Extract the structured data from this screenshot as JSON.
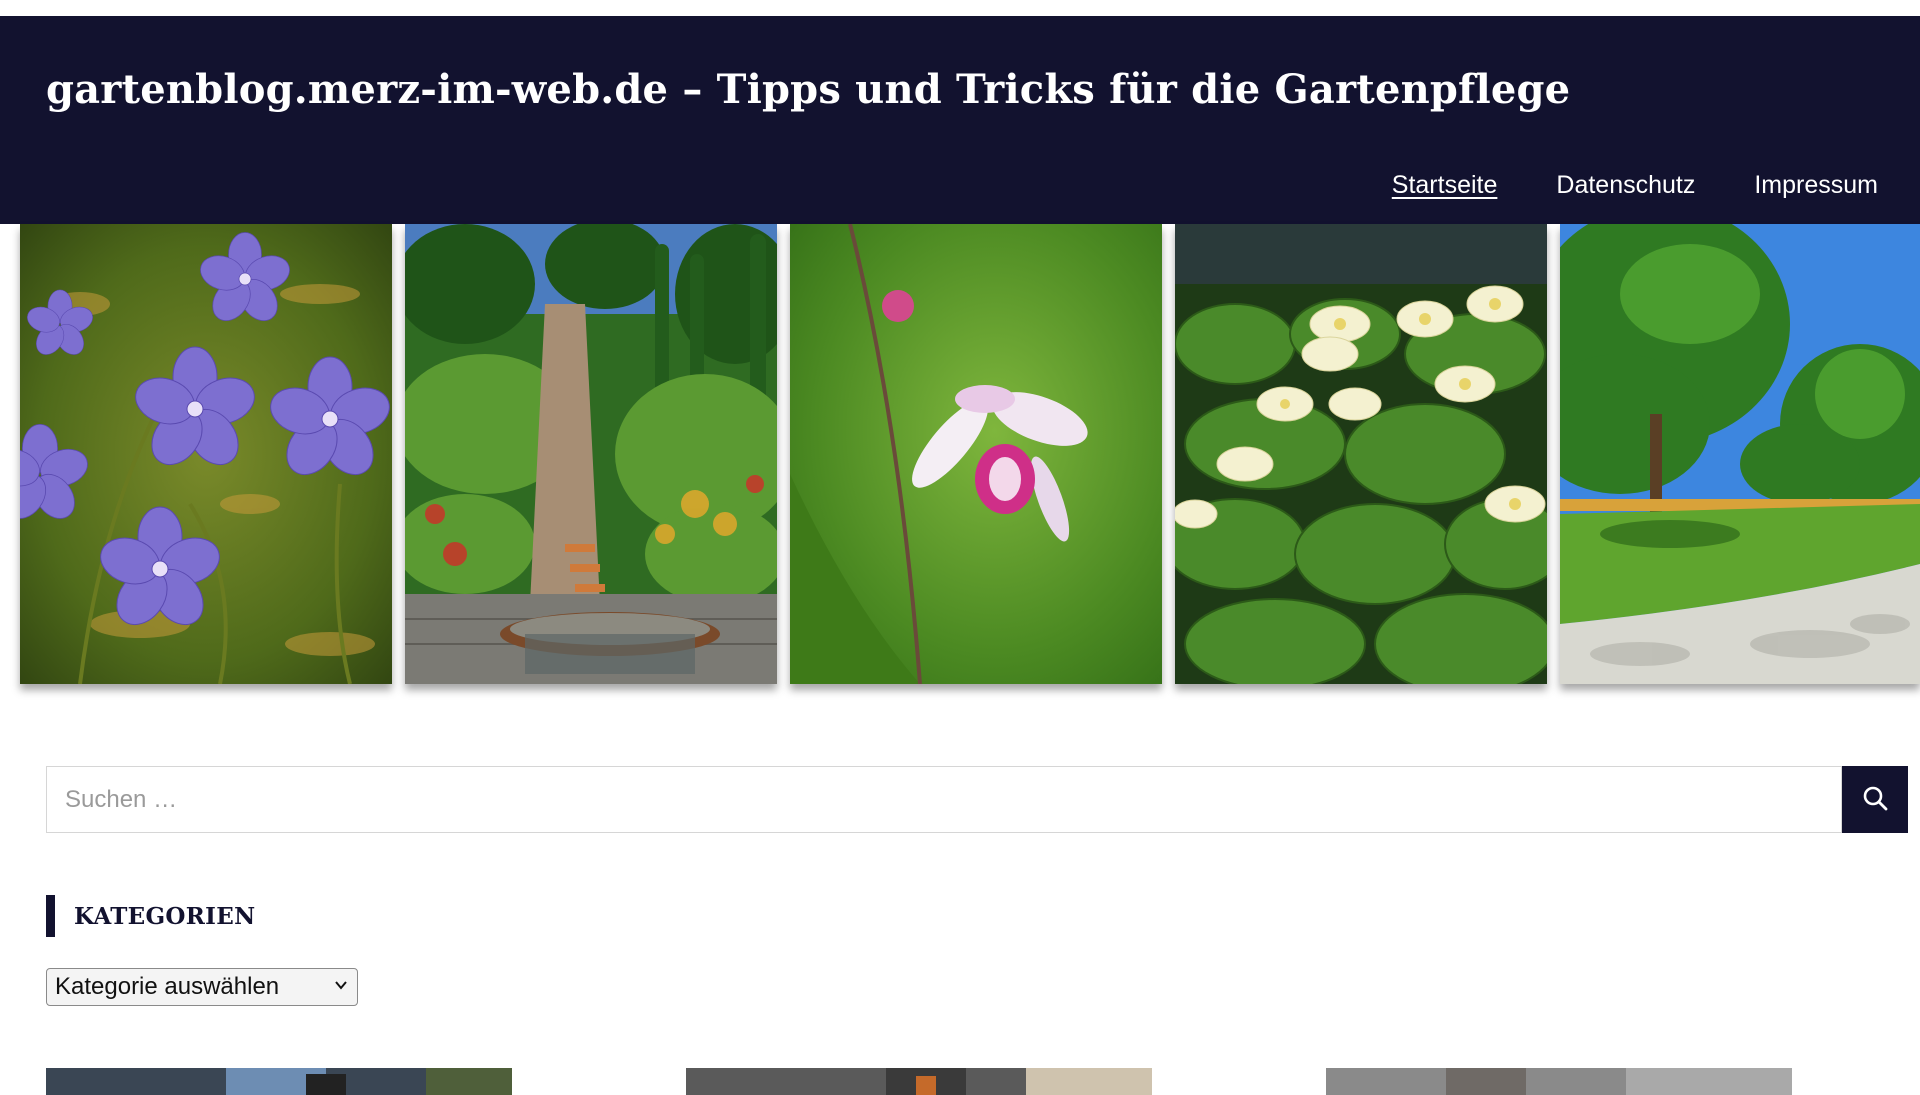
{
  "header": {
    "site_title": "gartenblog.merz-im-web.de – Tipps und Tricks für die Gartenpflege",
    "nav": [
      {
        "label": "Startseite",
        "active": true
      },
      {
        "label": "Datenschutz",
        "active": false
      },
      {
        "label": "Impressum",
        "active": false
      }
    ]
  },
  "search": {
    "placeholder": "Suchen …",
    "button_icon": "search-icon"
  },
  "categories": {
    "title": "KATEGORIEN",
    "select_value": "Kategorie auswählen"
  },
  "colors": {
    "header_bg": "#12122f",
    "accent": "#12122f"
  },
  "gallery": {
    "photos": [
      "geranium-flowers-photo",
      "terraced-garden-fountain-photo",
      "orchid-photo",
      "water-lilies-photo",
      "park-lawn-tree-photo"
    ]
  }
}
